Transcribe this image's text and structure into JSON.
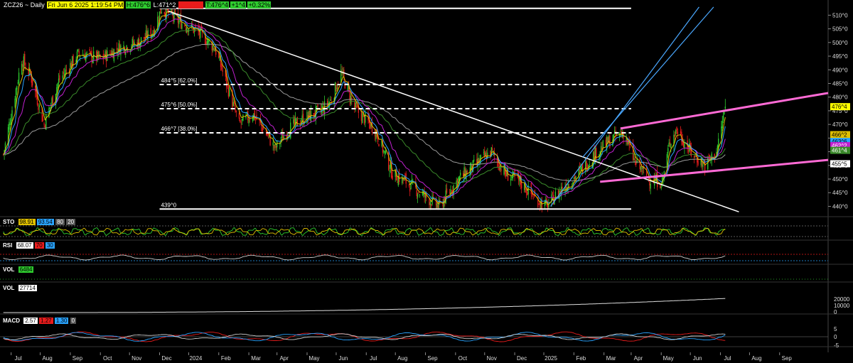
{
  "header": {
    "symbol": "ZCZ26 ~ Daily",
    "datetime": "Fri Jun 6 2025 1:19:54 PM",
    "high": "H:476^6",
    "low": "L:471^2",
    "close_tag": "C:475^2",
    "last": "T:476^4",
    "change": "+1^4",
    "change_pct": "+0.32%"
  },
  "colors": {
    "background": "#000000",
    "up": "#2ecc2e",
    "down": "#e81c1c",
    "ema_fast": "#29a3ff",
    "ema_slow": "#e0c000",
    "ma_magenta": "#c020d0",
    "ma_green": "#3a8a2a",
    "ma_gray": "#9a9a9a",
    "channel_blue": "#4aa8ff",
    "channel_pink": "#ff6ad5",
    "trendline": "#ffffff"
  },
  "price_axis": {
    "ticks": [
      "510^0",
      "505^0",
      "500^0",
      "495^0",
      "490^0",
      "485^0",
      "480^0",
      "475^0",
      "470^0",
      "465^0",
      "460^0",
      "455^0",
      "450^0",
      "445^0",
      "440^0"
    ]
  },
  "price_tags": [
    {
      "text": "476^4",
      "value": 476.5,
      "bg": "#ffff00",
      "fg": "#000000"
    },
    {
      "text": "466^2",
      "value": 466.25,
      "bg": "#e0c000",
      "fg": "#000000"
    },
    {
      "text": "463^6",
      "value": 463.75,
      "bg": "#29a3ff",
      "fg": "#000000"
    },
    {
      "text": "462^2",
      "value": 462.25,
      "bg": "#c020d0",
      "fg": "#ffffff"
    },
    {
      "text": "461^4",
      "value": 460.5,
      "bg": "#3a8a2a",
      "fg": "#ffffff"
    },
    {
      "text": "455^5",
      "value": 455.6,
      "bg": "#ffffff",
      "fg": "#000000"
    }
  ],
  "fib_levels": [
    {
      "label": "512^4",
      "value": 512.5,
      "style": "solid"
    },
    {
      "label": "484^5 [62.0%]",
      "value": 484.6,
      "style": "dashed"
    },
    {
      "label": "475^6 [50.0%]",
      "value": 475.75,
      "style": "dashed"
    },
    {
      "label": "466^7 [38.0%]",
      "value": 466.9,
      "style": "dashed"
    },
    {
      "label": "439^0",
      "value": 439.0,
      "style": "solid"
    }
  ],
  "time_axis": {
    "labels": [
      "Jun",
      "Jul",
      "Aug",
      "Sep",
      "Oct",
      "Nov",
      "Dec",
      "2024",
      "Feb",
      "Mar",
      "Apr",
      "May",
      "Jun",
      "Jul",
      "Aug",
      "Sep",
      "Oct",
      "Nov",
      "Dec",
      "2025",
      "Feb",
      "Mar",
      "Apr",
      "May",
      "Jun",
      "Jul",
      "Aug",
      "Sep"
    ]
  },
  "indicators": {
    "sto": {
      "label": "STO",
      "values": [
        "98.91",
        "93.54",
        "80",
        "20"
      ],
      "value_bgs": [
        "#e0c000",
        "#29a3ff",
        "#555555",
        "#555555"
      ]
    },
    "rsi": {
      "label": "RSI",
      "values": [
        "68.07",
        "70",
        "30"
      ],
      "value_bgs": [
        "#ffffff",
        "#e81c1c",
        "#29a3ff"
      ]
    },
    "vol1": {
      "label": "VOL",
      "values": [
        "6484"
      ],
      "value_bgs": [
        "#2ecc2e"
      ]
    },
    "vol2": {
      "label": "VOL",
      "values": [
        "27714"
      ],
      "value_bgs": [
        "#ffffff"
      ],
      "axis_ticks": [
        "20000",
        "10000",
        "0"
      ]
    },
    "macd": {
      "label": "MACD",
      "values": [
        "2.57",
        "1.27",
        "1.30",
        "0"
      ],
      "value_bgs": [
        "#ffffff",
        "#e81c1c",
        "#29a3ff",
        "#555555"
      ],
      "axis_ticks": [
        "5",
        "0",
        "-5"
      ]
    }
  },
  "chart_data": {
    "type": "candlestick",
    "title": "ZCZ26 ~ Daily",
    "xlabel": "",
    "ylabel": "",
    "ylim": [
      437,
      514
    ],
    "x_range": [
      "2023-05-22",
      "2025-09-20"
    ],
    "key_points": [
      {
        "date": "2023-05-24",
        "close": 459
      },
      {
        "date": "2023-06-12",
        "close": 494
      },
      {
        "date": "2023-06-21",
        "close": 488
      },
      {
        "date": "2023-07-05",
        "close": 470
      },
      {
        "date": "2023-07-20",
        "close": 486
      },
      {
        "date": "2023-08-10",
        "close": 496
      },
      {
        "date": "2023-09-01",
        "close": 494
      },
      {
        "date": "2023-09-20",
        "close": 498
      },
      {
        "date": "2023-10-10",
        "close": 500
      },
      {
        "date": "2023-10-25",
        "close": 504
      },
      {
        "date": "2023-11-03",
        "close": 512.5
      },
      {
        "date": "2023-11-20",
        "close": 508
      },
      {
        "date": "2023-12-10",
        "close": 504
      },
      {
        "date": "2023-12-28",
        "close": 498
      },
      {
        "date": "2024-01-08",
        "close": 486
      },
      {
        "date": "2024-01-22",
        "close": 470
      },
      {
        "date": "2024-02-05",
        "close": 474
      },
      {
        "date": "2024-02-20",
        "close": 466
      },
      {
        "date": "2024-02-28",
        "close": 461
      },
      {
        "date": "2024-03-12",
        "close": 468
      },
      {
        "date": "2024-03-28",
        "close": 472
      },
      {
        "date": "2024-04-15",
        "close": 475
      },
      {
        "date": "2024-04-26",
        "close": 479
      },
      {
        "date": "2024-05-06",
        "close": 489
      },
      {
        "date": "2024-05-20",
        "close": 476
      },
      {
        "date": "2024-06-10",
        "close": 468
      },
      {
        "date": "2024-06-28",
        "close": 452
      },
      {
        "date": "2024-07-12",
        "close": 449
      },
      {
        "date": "2024-07-30",
        "close": 444
      },
      {
        "date": "2024-08-15",
        "close": 440
      },
      {
        "date": "2024-09-04",
        "close": 450
      },
      {
        "date": "2024-09-24",
        "close": 456
      },
      {
        "date": "2024-10-08",
        "close": 460
      },
      {
        "date": "2024-10-22",
        "close": 452
      },
      {
        "date": "2024-11-06",
        "close": 449
      },
      {
        "date": "2024-11-22",
        "close": 443
      },
      {
        "date": "2024-12-04",
        "close": 440
      },
      {
        "date": "2024-12-18",
        "close": 446
      },
      {
        "date": "2025-01-06",
        "close": 452
      },
      {
        "date": "2025-01-22",
        "close": 459
      },
      {
        "date": "2025-02-10",
        "close": 465
      },
      {
        "date": "2025-02-21",
        "close": 467
      },
      {
        "date": "2025-03-05",
        "close": 456
      },
      {
        "date": "2025-03-20",
        "close": 450
      },
      {
        "date": "2025-04-02",
        "close": 449
      },
      {
        "date": "2025-04-10",
        "close": 464
      },
      {
        "date": "2025-04-17",
        "close": 468
      },
      {
        "date": "2025-05-01",
        "close": 460
      },
      {
        "date": "2025-05-16",
        "close": 455
      },
      {
        "date": "2025-05-28",
        "close": 460
      },
      {
        "date": "2025-06-06",
        "close": 476.5
      }
    ],
    "overlays": {
      "downtrend_line": [
        {
          "date": "2023-11-10",
          "value": 511.5
        },
        {
          "date": "2025-06-20",
          "value": 438
        }
      ],
      "blue_channel_lower": [
        {
          "date": "2024-12-08",
          "value": 440
        },
        {
          "date": "2025-05-10",
          "value": 513
        }
      ],
      "blue_channel_upper": [
        {
          "date": "2025-01-10",
          "value": 458
        },
        {
          "date": "2025-05-25",
          "value": 513
        }
      ],
      "pink_channel_upper": [
        {
          "date": "2025-02-18",
          "value": 468.5
        },
        {
          "date": "2025-09-20",
          "value": 481.5
        }
      ],
      "pink_channel_lower": [
        {
          "date": "2025-01-28",
          "value": 449
        },
        {
          "date": "2025-09-20",
          "value": 457
        }
      ]
    }
  }
}
